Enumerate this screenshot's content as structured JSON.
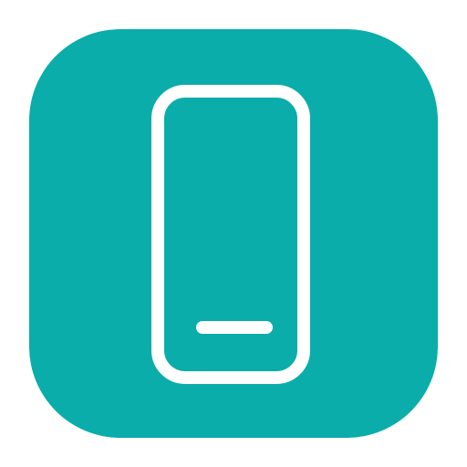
{
  "app_icon": {
    "icon": "mobile-phone-icon",
    "background_color": "#0AADAA",
    "foreground_color": "#FFFFFF"
  }
}
